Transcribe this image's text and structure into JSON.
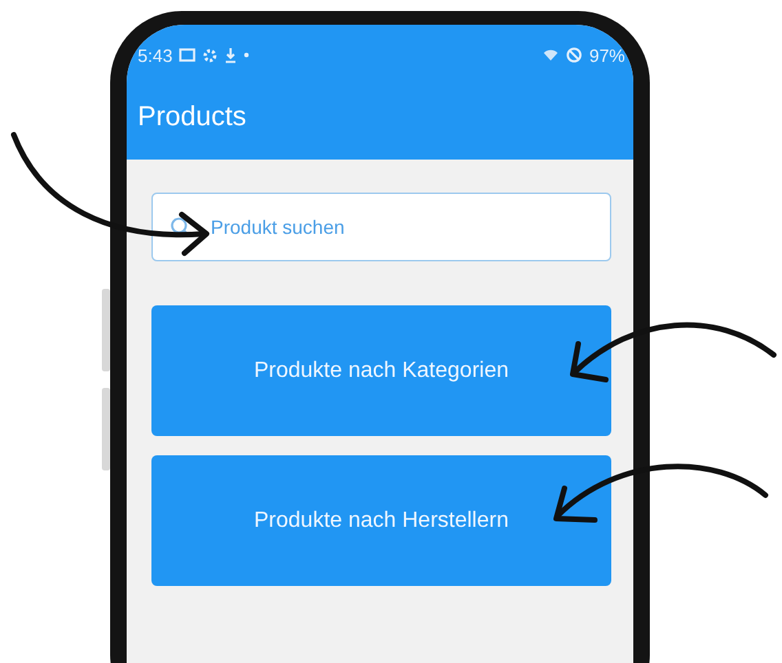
{
  "status_bar": {
    "time": "5:43",
    "battery": "97%"
  },
  "app_bar": {
    "title": "Products"
  },
  "search": {
    "placeholder": "Produkt suchen"
  },
  "buttons": [
    "Produkte nach Kategorien",
    "Produkte nach Herstellern"
  ]
}
